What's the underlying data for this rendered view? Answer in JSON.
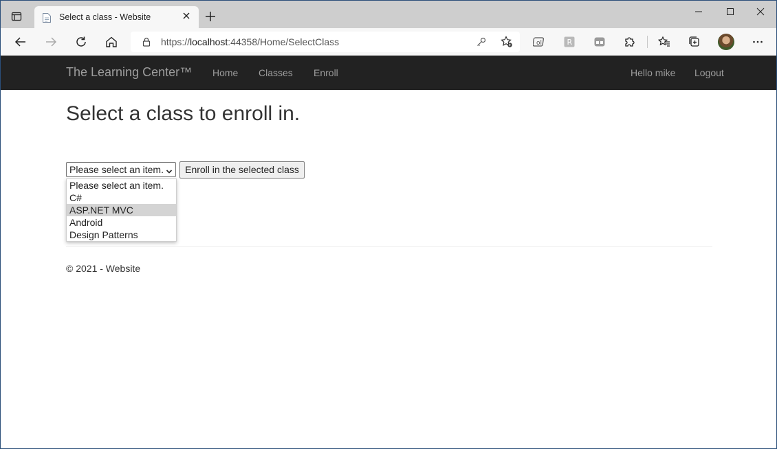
{
  "browser": {
    "tab_title": "Select a class - Website",
    "url_prefix": "https://",
    "url_host": "localhost",
    "url_rest": ":44358/Home/SelectClass"
  },
  "site": {
    "brand": "The Learning Center™",
    "nav": [
      "Home",
      "Classes",
      "Enroll"
    ],
    "greeting": "Hello mike",
    "logout": "Logout"
  },
  "main": {
    "heading": "Select a class to enroll in.",
    "select_value": "Please select an item.",
    "options": [
      "Please select an item.",
      "C#",
      "ASP.NET MVC",
      "Android",
      "Design Patterns"
    ],
    "highlighted_option": "ASP.NET MVC",
    "enroll_button": "Enroll in the selected class"
  },
  "footer": {
    "text": "© 2021 - Website"
  },
  "icons": {
    "tab_actions": "tab-actions-icon",
    "favicon": "page-icon",
    "close": "close-icon",
    "new_tab": "plus-icon",
    "minimize": "minimize-icon",
    "maximize": "maximize-icon",
    "window_close": "close-icon",
    "back": "back-arrow-icon",
    "forward": "forward-arrow-icon",
    "refresh": "refresh-icon",
    "home": "home-icon",
    "lock": "lock-icon",
    "key": "key-icon",
    "favorite_add": "star-add-icon",
    "extensions": "puzzle-icon",
    "favorites": "favorites-icon",
    "collections": "collections-icon",
    "more": "more-icon"
  },
  "colors": {
    "navbar_bg": "#222222",
    "nav_text": "#9d9d9d",
    "highlight": "#d4d4d4"
  }
}
